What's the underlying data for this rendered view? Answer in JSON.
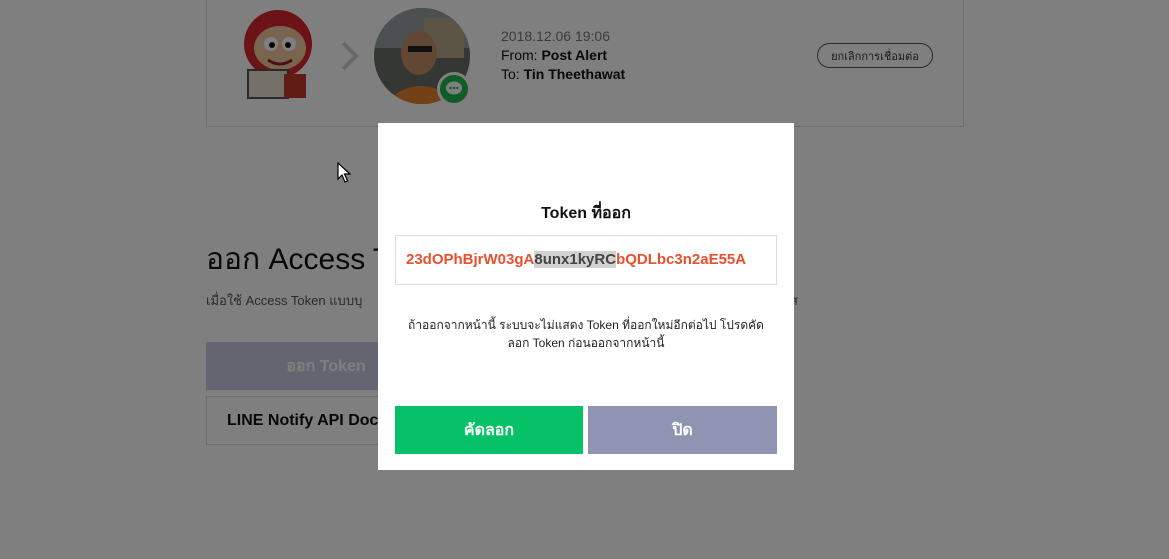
{
  "connection": {
    "date": "2018.12.06 19:06",
    "from_label": "From: ",
    "from_value": "Post Alert",
    "to_label": "To: ",
    "to_value": "Tin Theethawat",
    "disconnect_label": "ยกเลิกการเชื่อมต่อ"
  },
  "issue_section": {
    "title": "ออก Access T",
    "desc": "เมื่อใช้ Access Token แบบบุ",
    "desc_tail": "ส",
    "issue_button": "ออก Token",
    "doc_button": "LINE Notify API Doc"
  },
  "modal": {
    "title": "Token ที่ออก",
    "token_part1": "23dOPhBjrW03gA",
    "token_selected": "8unx1kyRC",
    "token_part2": "bQDLbc3n2aE55A",
    "note_line1": "ถ้าออกจากหน้านี้ ระบบจะไม่แสดง Token ที่ออกใหม่อีกต่อไป โปรดคัด",
    "note_line2": "ลอก Token ก่อนออกจากหน้านี้",
    "copy_button": "คัดลอก",
    "close_button": "ปิด"
  },
  "colors": {
    "accent_green": "#06c167",
    "token_red": "#e8502e",
    "close_gray": "#8e94b1"
  },
  "icons": [
    "mascot-avatar-icon",
    "chevron-right-icon",
    "user-avatar-icon",
    "chat-bubble-icon",
    "mouse-cursor-icon"
  ]
}
